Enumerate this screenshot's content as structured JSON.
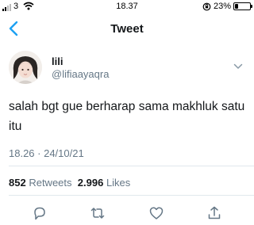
{
  "status_bar": {
    "carrier": "3",
    "time": "18.37",
    "battery_text": "23%",
    "battery_level": 0.23
  },
  "nav": {
    "title": "Tweet"
  },
  "tweet": {
    "display_name": "lili",
    "handle": "@lifiaayaqra",
    "text": "salah bgt gue berharap sama makhluk satu itu",
    "timestamp": "18.26 · 24/10/21",
    "retweet_count": "852",
    "retweets_label": "Retweets",
    "like_count": "2.996",
    "likes_label": "Likes"
  },
  "colors": {
    "accent": "#1da1f2",
    "secondary_text": "#657786",
    "icon_gray": "#657786"
  },
  "icons": [
    "back-icon",
    "chevron-down-icon",
    "reply-icon",
    "retweet-icon",
    "like-icon",
    "share-icon"
  ]
}
